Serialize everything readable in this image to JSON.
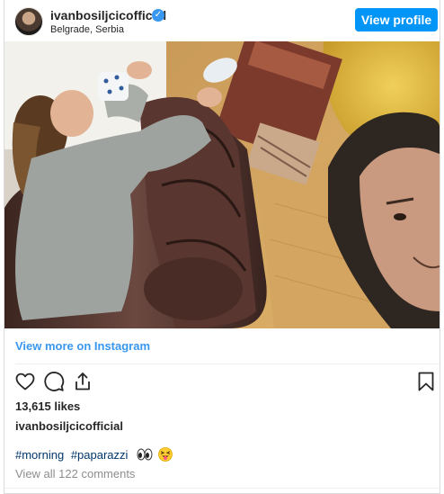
{
  "post": {
    "username": "ivanbosiljcicofficial",
    "location": "Belgrade, Serbia",
    "view_profile_label": "View profile",
    "view_more_label": "View more on Instagram",
    "likes": "13,615 likes",
    "caption_username": "ivanbosiljcicofficial",
    "hashtags": [
      "#morning",
      "#paparazzi"
    ],
    "comments_link": "View all 122 comments"
  },
  "icons": {
    "verified": "verified-badge-icon",
    "like": "heart-icon",
    "comment": "comment-bubble-icon",
    "share": "share-icon",
    "save": "bookmark-icon",
    "emoji_1": "eyes-emoji",
    "emoji_2": "squinting-face-with-tongue-emoji"
  },
  "colors": {
    "accent": "#0095f6",
    "link": "#3897f0",
    "hashtag": "#00376b",
    "muted": "#8e8e8e"
  }
}
